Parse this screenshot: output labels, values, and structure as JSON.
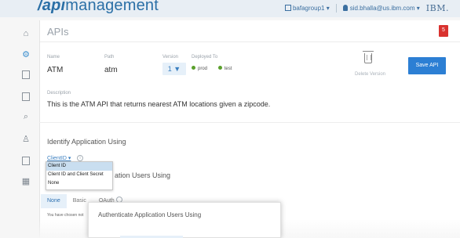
{
  "header": {
    "brand_prefix": "/api",
    "brand_suffix": "management",
    "org": "bafagroup1",
    "user": "sid.bhalla@us.ibm.com",
    "company": "IBM."
  },
  "sidebar": {
    "items": [
      {
        "name": "home-icon",
        "glyph": "⌂"
      },
      {
        "name": "apis-icon",
        "glyph": "⚙"
      },
      {
        "name": "products-icon",
        "glyph": "▤"
      },
      {
        "name": "plans-icon",
        "glyph": "▣"
      },
      {
        "name": "search-icon",
        "glyph": "⌕"
      },
      {
        "name": "users-icon",
        "glyph": "♙"
      },
      {
        "name": "drafts-icon",
        "glyph": "▦"
      },
      {
        "name": "analytics-icon",
        "glyph": "▩"
      }
    ]
  },
  "page": {
    "title": "APIs",
    "alert_count": "5"
  },
  "api": {
    "name_label": "Name",
    "name": "ATM",
    "path_label": "Path",
    "path": "atm",
    "version_label": "Version",
    "version": "1 ▼",
    "deployed_label": "Deployed To",
    "deployed": [
      "prod",
      "test"
    ],
    "delete_label": "Delete Version",
    "save_label": "Save API",
    "description_label": "Description",
    "description": "This is the ATM API that returns nearest ATM locations given a zipcode."
  },
  "identify": {
    "title": "Identify Application Using",
    "selected": "ClientID ▾",
    "options": [
      "Client ID",
      "Client ID and Client Secret",
      "None"
    ]
  },
  "authenticate": {
    "title_partial": "ation Users Using",
    "tabs": [
      "None",
      "Basic",
      "OAuth"
    ],
    "chosen_text": "You have chosen not"
  },
  "modal": {
    "title": "Authenticate Application Users Using"
  },
  "colors": {
    "brand": "#2a6fa6",
    "accent": "#2c7fd4",
    "alert": "#d9322f",
    "status_green": "#5aa02c"
  }
}
